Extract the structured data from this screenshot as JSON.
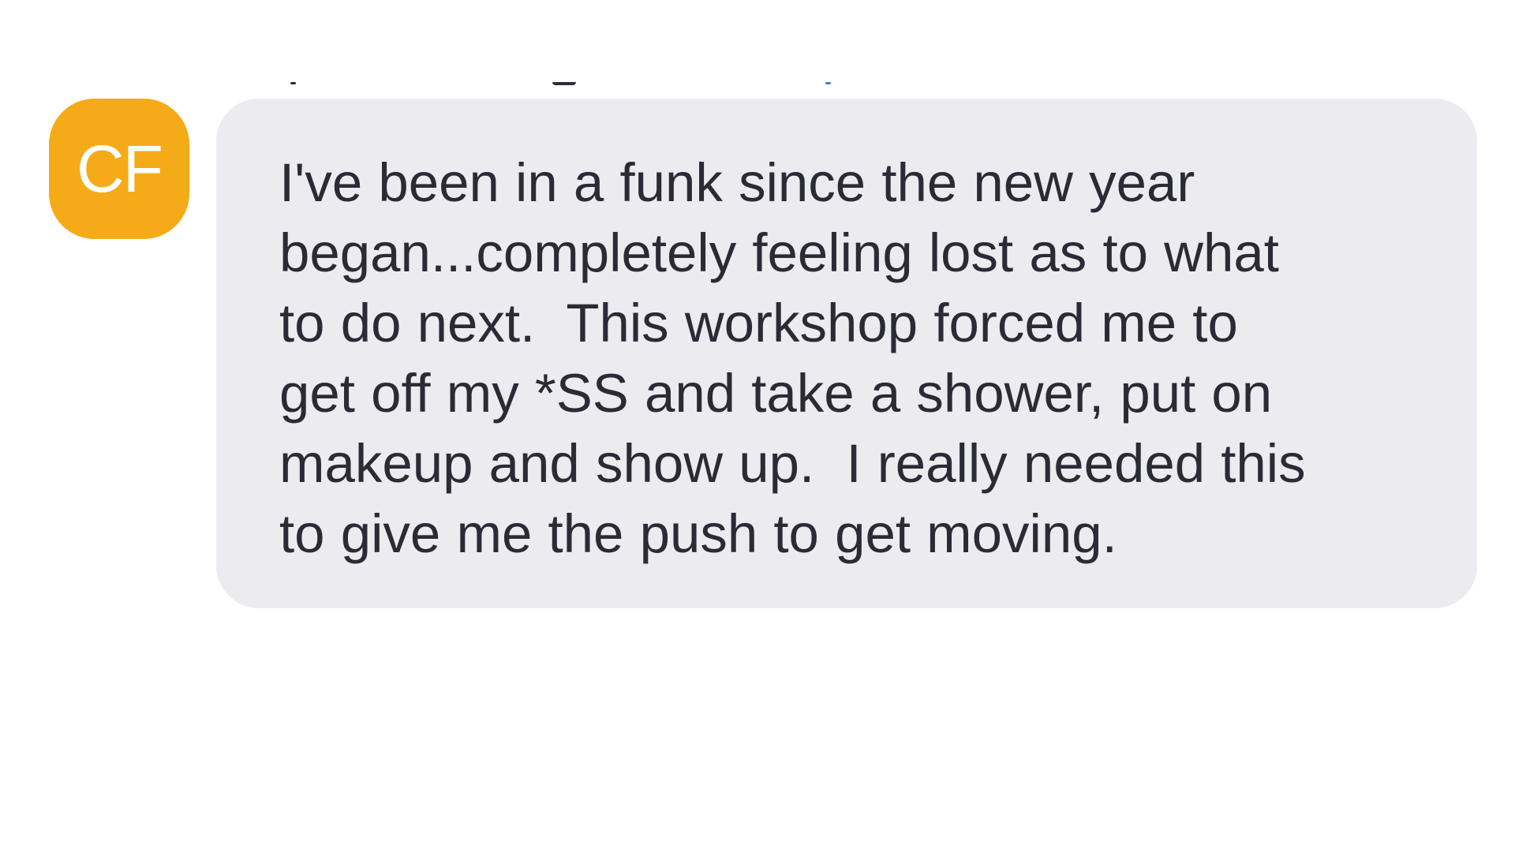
{
  "message": {
    "sender_initials": "CF",
    "avatar_color": "#f5ab17",
    "bubble_color": "#ececf0",
    "text_color": "#2b2b36",
    "text": "I've been in a funk since the new year\nbegan...completely feeling lost as to what\nto do next.  This workshop forced me to\nget off my *SS and take a shower, put on\nmakeup and show up.  I really needed this\nto give me the push to get moving."
  }
}
